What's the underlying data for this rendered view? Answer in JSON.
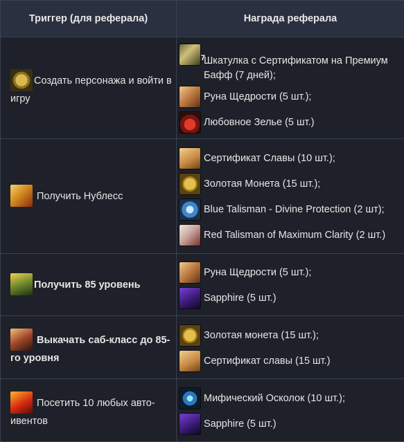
{
  "table": {
    "headers": {
      "trigger": "Триггер (для реферала)",
      "reward": "Награда реферала"
    },
    "rows": [
      {
        "trigger": {
          "icon": "gold-coin-icon",
          "text": "Создать персонажа и войти в игру",
          "bold": false
        },
        "rewards": [
          {
            "icon": "premium-box-icon",
            "badge": "7",
            "text": "Шкатулка с Сертификатом на Премиум Бафф (7 дней);"
          },
          {
            "icon": "rune-icon",
            "text": "Руна Щедрости (5 шт.);"
          },
          {
            "icon": "love-potion-icon",
            "text": "Любовное Зелье (5 шт.)"
          }
        ]
      },
      {
        "trigger": {
          "icon": "noblesse-wings-icon",
          "text": "Получить Нублесс",
          "bold": false
        },
        "rewards": [
          {
            "icon": "certificate-icon",
            "text": "Сертификат Славы (10 шт.);"
          },
          {
            "icon": "gold-coin-icon",
            "text": "Золотая Монета (15 шт.);"
          },
          {
            "icon": "blue-talisman-icon",
            "text": "Blue Talisman - Divine Protection (2 шт);"
          },
          {
            "icon": "red-talisman-icon",
            "text": "Red Talisman of Maximum Clarity (2 шт.)"
          }
        ]
      },
      {
        "trigger": {
          "icon": "level-85-icon",
          "text": "Получить 85 уровень",
          "bold": true
        },
        "rewards": [
          {
            "icon": "rune-icon",
            "text": "Руна Щедрости (5 шт.);"
          },
          {
            "icon": "sapphire-icon",
            "text": "Sapphire (5 шт.)"
          }
        ]
      },
      {
        "trigger": {
          "icon": "subclass-icon",
          "text": "Выкачать саб-класс до 85-го уровня",
          "bold": true
        },
        "rewards": [
          {
            "icon": "gold-coin-icon",
            "text": "Золотая монета (15 шт.);"
          },
          {
            "icon": "certificate-icon",
            "text": "Сертификат славы (15 шт.)"
          }
        ]
      },
      {
        "trigger": {
          "icon": "auto-events-icon",
          "text": "Посетить 10 любых авто-ивентов",
          "bold": false
        },
        "rewards": [
          {
            "icon": "mythic-shard-icon",
            "text": "Мифический Осколок (10 шт.);"
          },
          {
            "icon": "sapphire-icon",
            "text": "Sapphire (5 шт.)"
          }
        ]
      }
    ]
  }
}
